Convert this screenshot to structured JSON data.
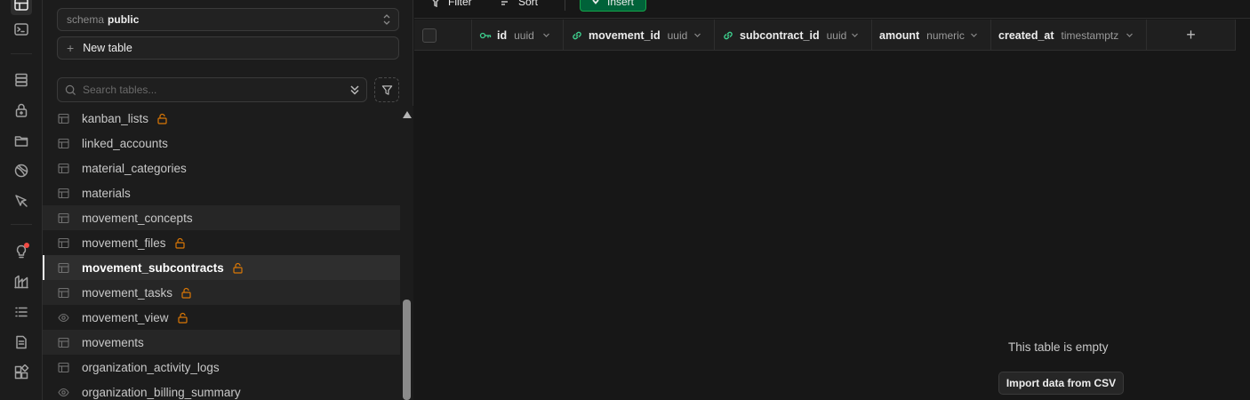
{
  "rail": {
    "icons": [
      "table-editor-icon",
      "sql-editor-icon",
      "database-icon",
      "auth-icon",
      "storage-icon",
      "realtime-icon",
      "edge-functions-icon",
      "advisors-icon",
      "reports-icon",
      "logs-icon",
      "api-docs-icon",
      "integrations-icon"
    ]
  },
  "sidebar": {
    "schema_label": "schema",
    "schema_value": "public",
    "new_table_label": "New table",
    "search_placeholder": "Search tables...",
    "tables": [
      {
        "name": "kanban_lists",
        "locked": true,
        "view": false
      },
      {
        "name": "linked_accounts",
        "locked": false,
        "view": false
      },
      {
        "name": "material_categories",
        "locked": false,
        "view": false
      },
      {
        "name": "materials",
        "locked": false,
        "view": false
      },
      {
        "name": "movement_concepts",
        "locked": false,
        "view": false
      },
      {
        "name": "movement_files",
        "locked": true,
        "view": false
      },
      {
        "name": "movement_subcontracts",
        "locked": true,
        "view": false
      },
      {
        "name": "movement_tasks",
        "locked": true,
        "view": false
      },
      {
        "name": "movement_view",
        "locked": true,
        "view": true
      },
      {
        "name": "movements",
        "locked": false,
        "view": false
      },
      {
        "name": "organization_activity_logs",
        "locked": false,
        "view": false
      },
      {
        "name": "organization_billing_summary",
        "locked": false,
        "view": true
      }
    ],
    "selected": "movement_subcontracts"
  },
  "toolbar": {
    "filter_label": "Filter",
    "sort_label": "Sort",
    "insert_label": "Insert"
  },
  "grid": {
    "columns": [
      {
        "name": "id",
        "type": "uuid",
        "icon": "primary-key-icon"
      },
      {
        "name": "movement_id",
        "type": "uuid",
        "icon": "foreign-key-link-icon"
      },
      {
        "name": "subcontract_id",
        "type": "uuid",
        "icon": "foreign-key-link-icon"
      },
      {
        "name": "amount",
        "type": "numeric",
        "icon": ""
      },
      {
        "name": "created_at",
        "type": "timestamptz",
        "icon": ""
      }
    ],
    "add_column_label": "+"
  },
  "empty_state": {
    "title": "This table is empty",
    "import_label": "Import data from CSV"
  },
  "colors": {
    "accent_green": "#3ecf8e",
    "insert_bg": "#006239",
    "lock": "#d97706",
    "notification": "#f24b44"
  }
}
